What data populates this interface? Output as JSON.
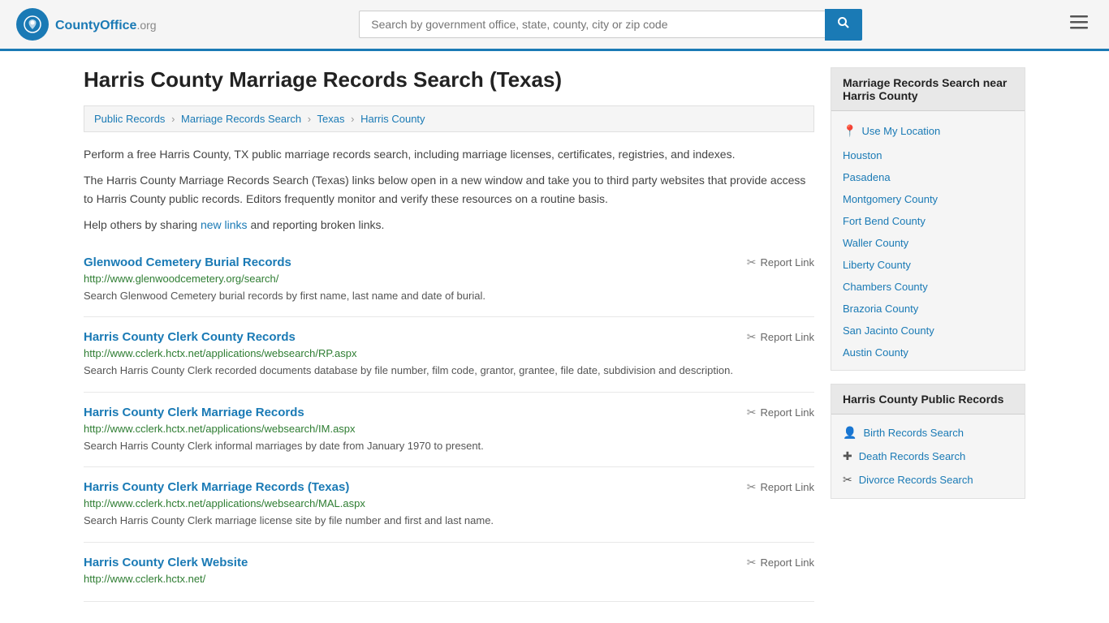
{
  "header": {
    "logo_text": "CountyOffice",
    "logo_suffix": ".org",
    "search_placeholder": "Search by government office, state, county, city or zip code",
    "search_icon": "🔍"
  },
  "page": {
    "title": "Harris County Marriage Records Search (Texas)",
    "breadcrumb": [
      {
        "label": "Public Records",
        "href": "#"
      },
      {
        "label": "Marriage Records Search",
        "href": "#"
      },
      {
        "label": "Texas",
        "href": "#"
      },
      {
        "label": "Harris County",
        "href": "#"
      }
    ],
    "description1": "Perform a free Harris County, TX public marriage records search, including marriage licenses, certificates, registries, and indexes.",
    "description2": "The Harris County Marriage Records Search (Texas) links below open in a new window and take you to third party websites that provide access to Harris County public records. Editors frequently monitor and verify these resources on a routine basis.",
    "description3_before": "Help others by sharing ",
    "description3_link": "new links",
    "description3_after": " and reporting broken links."
  },
  "records": [
    {
      "title": "Glenwood Cemetery Burial Records",
      "url": "http://www.glenwoodcemetery.org/search/",
      "description": "Search Glenwood Cemetery burial records by first name, last name and date of burial.",
      "report_label": "Report Link"
    },
    {
      "title": "Harris County Clerk County Records",
      "url": "http://www.cclerk.hctx.net/applications/websearch/RP.aspx",
      "description": "Search Harris County Clerk recorded documents database by file number, film code, grantor, grantee, file date, subdivision and description.",
      "report_label": "Report Link"
    },
    {
      "title": "Harris County Clerk Marriage Records",
      "url": "http://www.cclerk.hctx.net/applications/websearch/IM.aspx",
      "description": "Search Harris County Clerk informal marriages by date from January 1970 to present.",
      "report_label": "Report Link"
    },
    {
      "title": "Harris County Clerk Marriage Records (Texas)",
      "url": "http://www.cclerk.hctx.net/applications/websearch/MAL.aspx",
      "description": "Search Harris County Clerk marriage license site by file number and first and last name.",
      "report_label": "Report Link"
    },
    {
      "title": "Harris County Clerk Website",
      "url": "http://www.cclerk.hctx.net/",
      "description": "",
      "report_label": "Report Link"
    }
  ],
  "sidebar": {
    "nearby_section_title": "Marriage Records Search near Harris County",
    "use_location_label": "Use My Location",
    "nearby_items": [
      {
        "label": "Houston"
      },
      {
        "label": "Pasadena"
      },
      {
        "label": "Montgomery County"
      },
      {
        "label": "Fort Bend County"
      },
      {
        "label": "Waller County"
      },
      {
        "label": "Liberty County"
      },
      {
        "label": "Chambers County"
      },
      {
        "label": "Brazoria County"
      },
      {
        "label": "San Jacinto County"
      },
      {
        "label": "Austin County"
      }
    ],
    "public_records_section_title": "Harris County Public Records",
    "public_records_items": [
      {
        "label": "Birth Records Search",
        "icon": "person"
      },
      {
        "label": "Death Records Search",
        "icon": "plus"
      },
      {
        "label": "Divorce Records Search",
        "icon": "scissors"
      }
    ]
  }
}
